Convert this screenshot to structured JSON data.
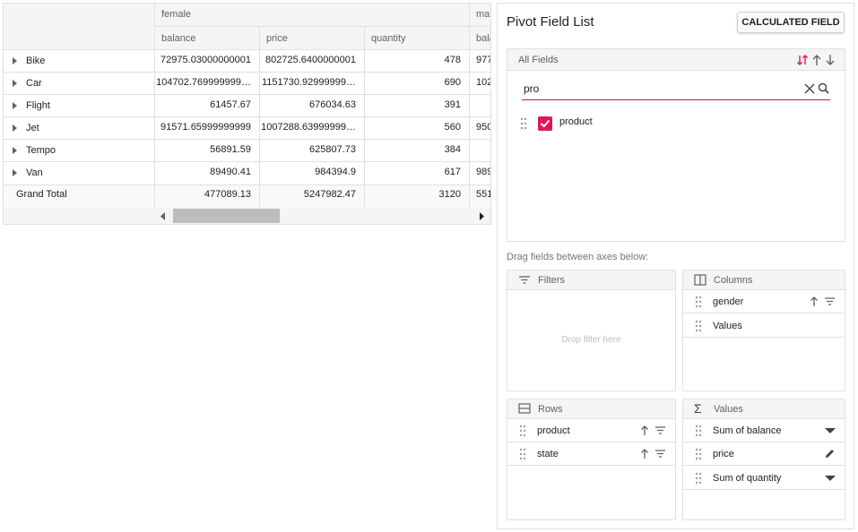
{
  "grid": {
    "col_group_1": "female",
    "col_group_2": "mal",
    "measures": [
      "balance",
      "price",
      "quantity",
      "bala"
    ],
    "rows": [
      {
        "label": "Bike",
        "balance": "72975.03000000001",
        "price": "802725.6400000001",
        "quantity": "478",
        "extra": "977"
      },
      {
        "label": "Car",
        "balance": "104702.769999999…",
        "price": "1151730.92999999…",
        "quantity": "690",
        "extra": "102"
      },
      {
        "label": "Flight",
        "balance": "61457.67",
        "price": "676034.63",
        "quantity": "391",
        "extra": ""
      },
      {
        "label": "Jet",
        "balance": "91571.65999999999",
        "price": "1007288.63999999…",
        "quantity": "560",
        "extra": "950"
      },
      {
        "label": "Tempo",
        "balance": "56891.59",
        "price": "625807.73",
        "quantity": "384",
        "extra": ""
      },
      {
        "label": "Van",
        "balance": "89490.41",
        "price": "984394.9",
        "quantity": "617",
        "extra": "989"
      }
    ],
    "grand_total": {
      "label": "Grand Total",
      "balance": "477089.13",
      "price": "5247982.47",
      "quantity": "3120",
      "extra": "551"
    }
  },
  "field_list": {
    "title": "Pivot Field List",
    "calculated_field_button": "CALCULATED FIELD",
    "all_fields_label": "All Fields",
    "search_value": "pro",
    "fields": [
      {
        "name": "product",
        "checked": true
      }
    ],
    "drag_hint": "Drag fields between axes below:",
    "filters": {
      "title": "Filters",
      "placeholder": "Drop filter here"
    },
    "columns": {
      "title": "Columns",
      "items": [
        "gender",
        "Values"
      ]
    },
    "rows": {
      "title": "Rows",
      "items": [
        "product",
        "state"
      ]
    },
    "values": {
      "title": "Values",
      "items": [
        "Sum of balance",
        "price",
        "Sum of quantity"
      ]
    }
  },
  "colors": {
    "accent": "#e3165b",
    "border": "#e0e0e0",
    "header_bg": "#f5f5f5"
  },
  "icons": [
    "expand-arrow-icon",
    "sort-toggle-icon",
    "sort-ascending-icon",
    "sort-descending-icon",
    "clear-icon",
    "search-icon",
    "drag-grip-icon",
    "filter-icon",
    "columns-icon",
    "rows-icon",
    "sigma-icon",
    "dropdown-icon",
    "edit-icon",
    "checkmark-icon",
    "scroll-left-icon",
    "scroll-right-icon"
  ]
}
